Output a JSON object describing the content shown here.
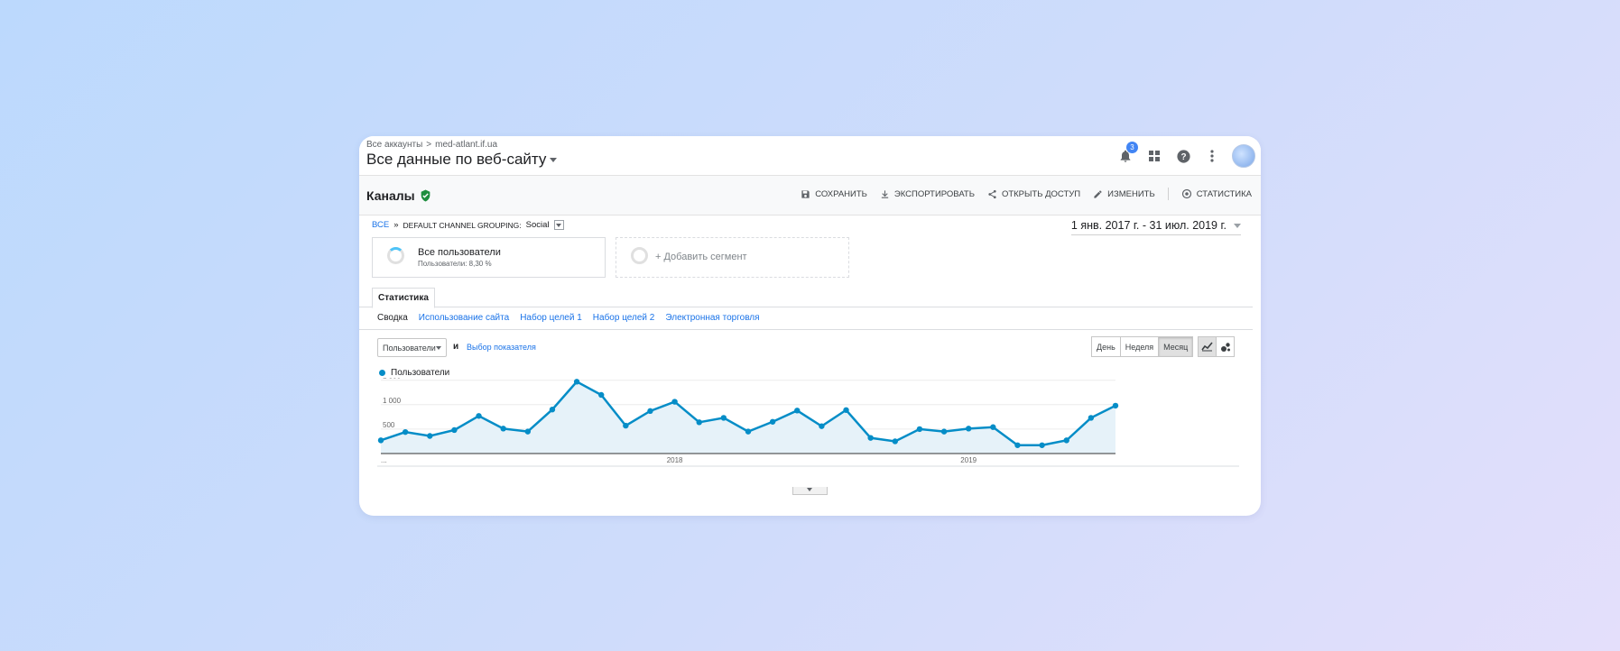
{
  "header": {
    "breadcrumb": [
      "Все аккаунты",
      "med-atlant.if.ua"
    ],
    "breadcrumb_sep": ">",
    "view_title": "Все данные по веб-сайту",
    "notification_count": "3",
    "icons": [
      "bell-icon",
      "apps-grid-icon",
      "help-icon",
      "more-vert-icon",
      "avatar"
    ]
  },
  "report": {
    "title": "Каналы",
    "actions": [
      {
        "label": "СОХРАНИТЬ",
        "icon": "save-icon"
      },
      {
        "label": "ЭКСПОРТИРОВАТЬ",
        "icon": "download-icon"
      },
      {
        "label": "ОТКРЫТЬ ДОСТУП",
        "icon": "share-icon"
      },
      {
        "label": "ИЗМЕНИТЬ",
        "icon": "edit-icon"
      },
      {
        "label": "СТАТИСТИКА",
        "icon": "insights-icon"
      }
    ]
  },
  "filter": {
    "all": "ВСЕ",
    "sep": "»",
    "grouping": "DEFAULT CHANNEL GROUPING:",
    "value": "Social"
  },
  "date_range": "1 янв. 2017 г. - 31 июл. 2019 г.",
  "segments": [
    {
      "name": "Все пользователи",
      "sub": "Пользователи: 8,30 %"
    },
    {
      "name": "+ Добавить сегмент"
    }
  ],
  "tab": "Статистика",
  "subtabs": [
    "Сводка",
    "Использование сайта",
    "Набор целей 1",
    "Набор целей 2",
    "Электронная торговля"
  ],
  "chart_controls": {
    "metric": "Пользователи",
    "and": "и",
    "pick_metric": "Выбор показателя",
    "granularity": [
      "День",
      "Неделя",
      "Месяц"
    ],
    "active_granularity": "Месяц"
  },
  "chart_data": {
    "type": "area",
    "series": [
      {
        "name": "Пользователи",
        "color": "#058dc7",
        "values": [
          270,
          440,
          360,
          480,
          770,
          510,
          450,
          900,
          1470,
          1200,
          570,
          870,
          1060,
          640,
          730,
          450,
          650,
          880,
          560,
          890,
          320,
          250,
          500,
          450,
          510,
          540,
          170,
          170,
          270,
          730,
          980
        ]
      }
    ],
    "x_start": "Январь 2017",
    "x_end": "Июль 2019",
    "x_tick_labels": [
      "...",
      "2018",
      "2019"
    ],
    "y_tick_labels": [
      "500",
      "1 000",
      "1 500"
    ],
    "ylim": [
      0,
      1550
    ],
    "grid": true
  }
}
